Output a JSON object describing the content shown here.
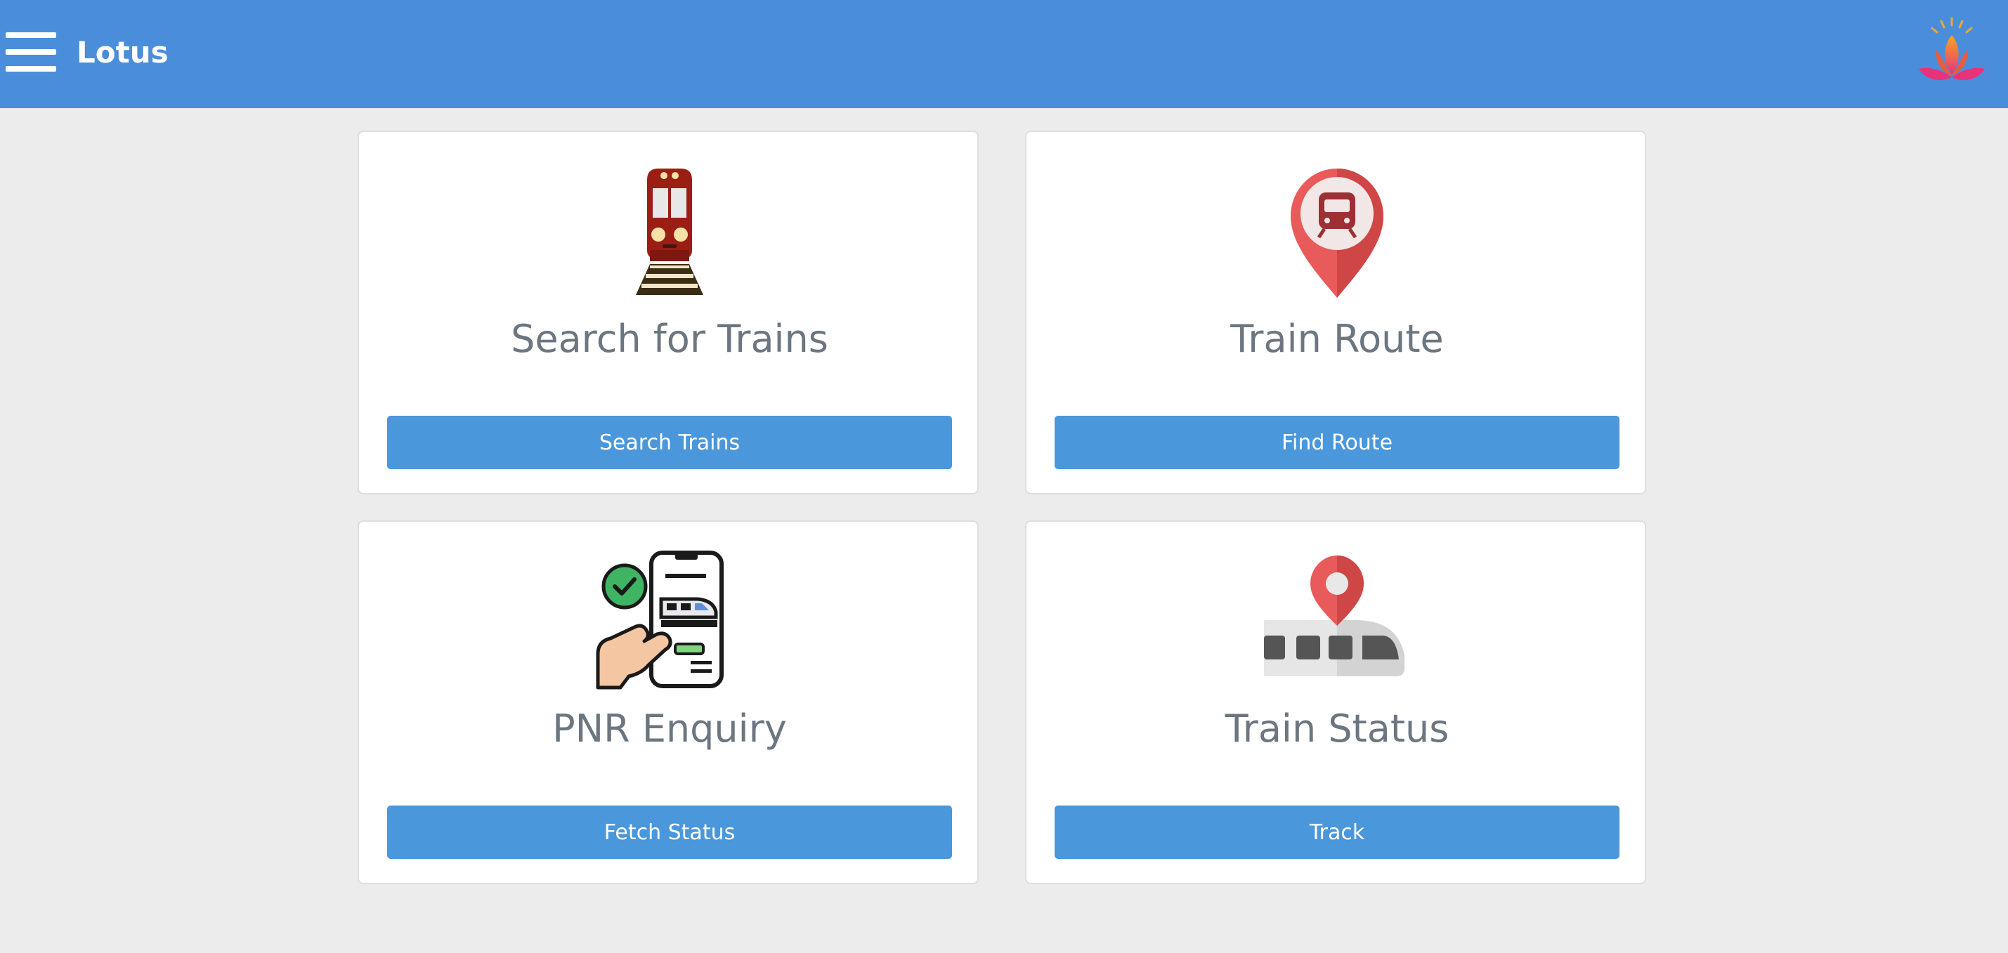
{
  "header": {
    "brand": "Lotus",
    "menu_icon": "hamburger-menu-icon",
    "logo_icon": "lotus-logo-icon",
    "background": "#4a8edb"
  },
  "cards": [
    {
      "icon": "train-icon",
      "title": "Search for Trains",
      "button": "Search Trains"
    },
    {
      "icon": "location-pin-train-icon",
      "title": "Train Route",
      "button": "Find Route"
    },
    {
      "icon": "phone-ticket-icon",
      "title": "PNR Enquiry",
      "button": "Fetch Status"
    },
    {
      "icon": "train-tracking-icon",
      "title": "Train Status",
      "button": "Track"
    }
  ],
  "colors": {
    "accent_button": "#4a97db",
    "title_text": "#6c7680",
    "page_background": "#ececec"
  }
}
